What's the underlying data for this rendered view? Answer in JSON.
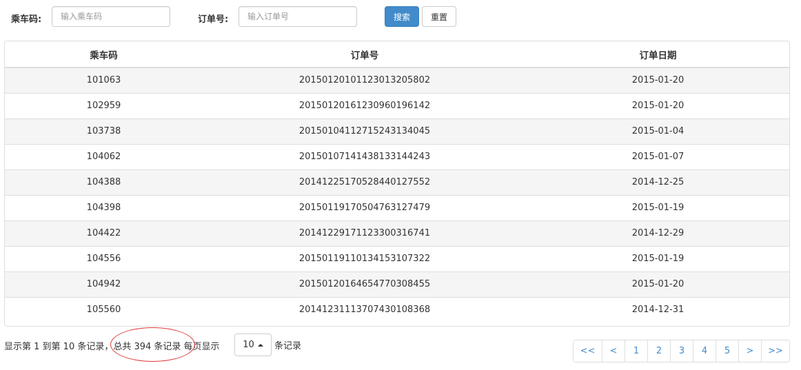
{
  "search": {
    "car_code_label": "乘车码:",
    "car_code_placeholder": "输入乘车码",
    "order_no_label": "订单号:",
    "order_no_placeholder": "输入订单号",
    "search_button": "搜索",
    "reset_button": "重置"
  },
  "table": {
    "headers": [
      "乘车码",
      "订单号",
      "订单日期"
    ],
    "rows": [
      [
        "101063",
        "20150120101123013205802",
        "2015-01-20"
      ],
      [
        "102959",
        "20150120161230960196142",
        "2015-01-20"
      ],
      [
        "103738",
        "20150104112715243134045",
        "2015-01-04"
      ],
      [
        "104062",
        "20150107141438133144243",
        "2015-01-07"
      ],
      [
        "104388",
        "20141225170528440127552",
        "2014-12-25"
      ],
      [
        "104398",
        "20150119170504763127479",
        "2015-01-19"
      ],
      [
        "104422",
        "20141229171123300316741",
        "2014-12-29"
      ],
      [
        "104556",
        "20150119110134153107322",
        "2015-01-19"
      ],
      [
        "104942",
        "20150120164654770308455",
        "2015-01-20"
      ],
      [
        "105560",
        "20141231113707430108368",
        "2014-12-31"
      ]
    ]
  },
  "footer": {
    "range_text": "显示第 1 到第 10 条记录，",
    "total_text": "总共 394 条记录",
    "per_page_prefix": " 每页显示",
    "page_size_value": "10",
    "per_page_suffix": "条记录"
  },
  "pagination": {
    "first": "<<",
    "prev": "<",
    "pages": [
      "1",
      "2",
      "3",
      "4",
      "5"
    ],
    "next": ">",
    "last": ">>"
  },
  "colors": {
    "primary": "#428bca",
    "annotation_circle": "#e03a3a",
    "row_stripe": "#f5f5f5",
    "border": "#dddddd"
  }
}
